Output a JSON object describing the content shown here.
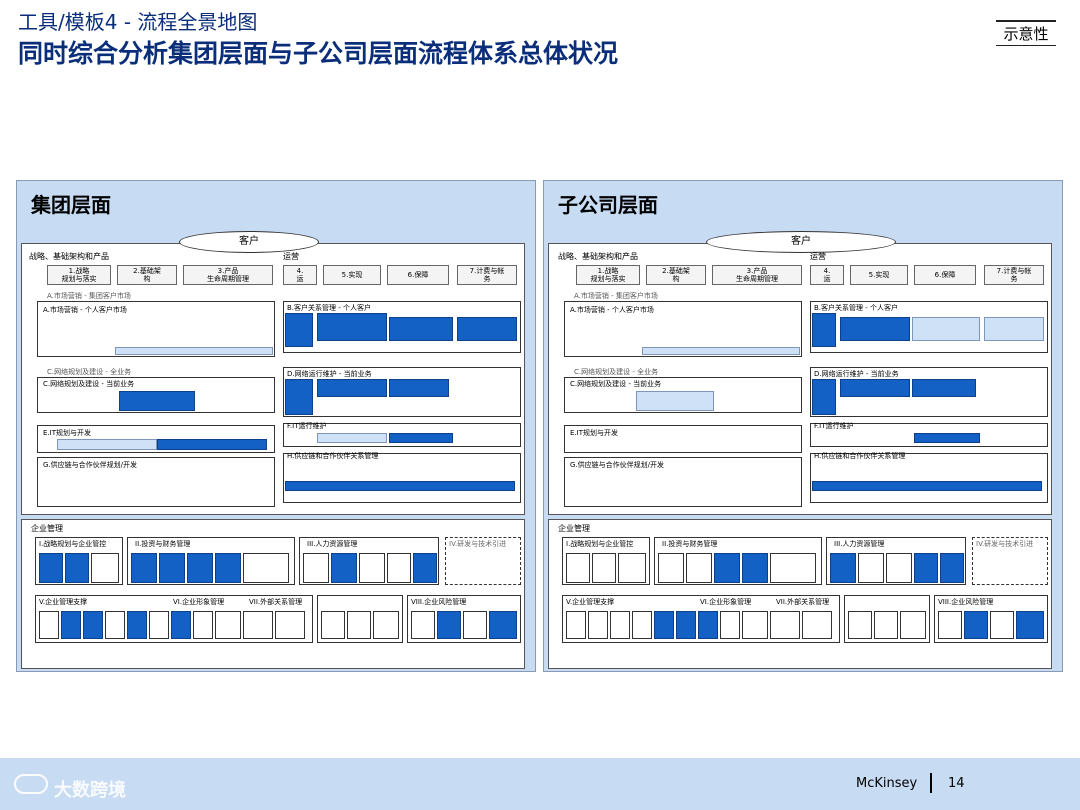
{
  "header": {
    "subtitle": "工具/模板4 - 流程全景地图",
    "title": "同时综合分析集团层面与子公司层面流程体系总体状况",
    "badge": "示意性"
  },
  "panels": [
    {
      "title": "集团层面",
      "customer": "客户",
      "strategy": {
        "title": "战略、基础架构和产品",
        "cols": [
          "1.战略\n规划与落实",
          "2.基础架\n构",
          "3.产品\n生命周期管理"
        ],
        "market_group": "A.市场营销 - 集团客户市场",
        "market_personal": "A.市场营销 - 个人客户市场",
        "network_all": "C.网络规划及建设 - 全业务",
        "network_current": "C.网络规划及建设 - 当前业务",
        "it": "E.IT规划与开发",
        "supply": "G.供应链与合作伙伴规划/开发"
      },
      "ops": {
        "title": "运营",
        "cols": [
          "4.\n运",
          "5.实现",
          "6.保障",
          "7.计费与帐\n务"
        ],
        "b": "B.客户关系管理 - 个人客户",
        "d": "D.网络运行维护 - 当前业务",
        "f": "F.IT运行维护",
        "h": "H.供应链和合作伙伴关系管理"
      },
      "enterprise": {
        "title": "企业管理",
        "i": "I.战略规划与企业管控",
        "ii": "II.投资与财务管理",
        "iii": "III.人力资源管理",
        "iv": "IV.研发与技术引进",
        "v": "V.企业管理支撑",
        "vi": "VI.企业形象管理",
        "vii": "VII.外部关系管理",
        "viii": "VIII.企业风险管理"
      }
    },
    {
      "title": "子公司层面",
      "customer": "客户",
      "strategy": {
        "title": "战略、基础架构和产品",
        "cols": [
          "1.战略\n规划与落实",
          "2.基础架\n构",
          "3.产品\n生命周期管理"
        ],
        "market_group": "A.市场营销 - 集团客户市场",
        "market_personal": "A.市场营销 - 个人客户市场",
        "network_all": "C.网络规划及建设 - 全业务",
        "network_current": "C.网络规划及建设 - 当前业务",
        "it": "E.IT规划与开发",
        "supply": "G.供应链与合作伙伴规划/开发"
      },
      "ops": {
        "title": "运营",
        "cols": [
          "4.\n运",
          "5.实现",
          "6.保障",
          "7.计费与帐\n务"
        ],
        "b": "B.客户关系管理 - 个人客户",
        "d": "D.网络运行维护 - 当前业务",
        "f": "F.IT运行维护",
        "h": "H.供应链和合作伙伴关系管理"
      },
      "enterprise": {
        "title": "企业管理",
        "i": "I.战略规划与企业管控",
        "ii": "II.投资与财务管理",
        "iii": "III.人力资源管理",
        "iv": "IV.研发与技术引进",
        "v": "V.企业管理支撑",
        "vi": "VI.企业形象管理",
        "vii": "VII.外部关系管理",
        "viii": "VIII.企业风险管理"
      }
    }
  ],
  "footer": {
    "brand": "McKinsey",
    "page": "14",
    "watermark": "大数跨境"
  },
  "colors": {
    "accent": "#1461c6",
    "panel_bg": "#c7dbf3",
    "title": "#0b2e7a"
  }
}
